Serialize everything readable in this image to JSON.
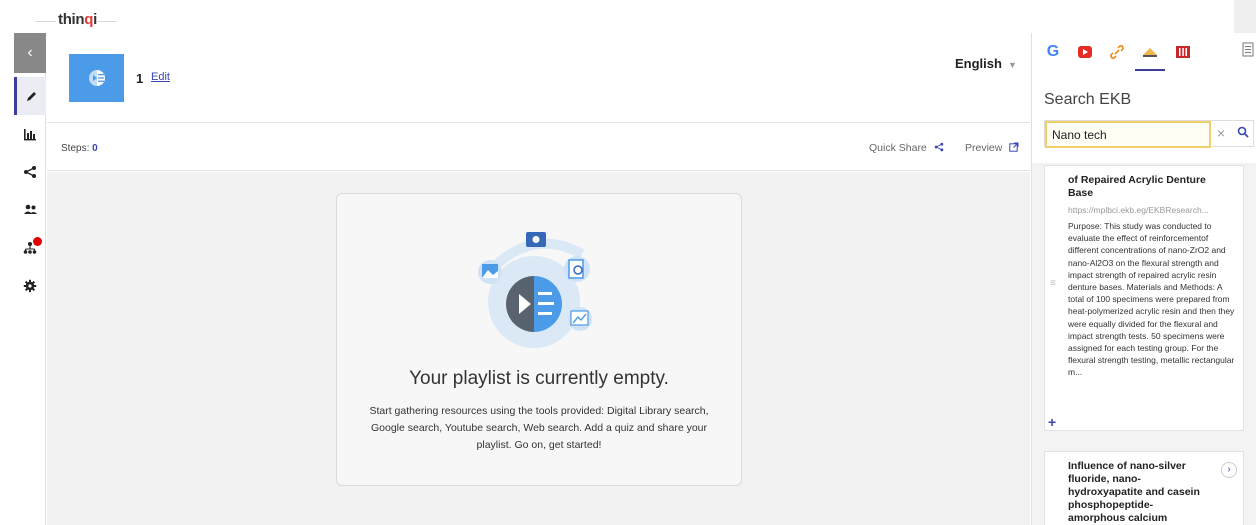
{
  "app": {
    "logo_prefix": "thin",
    "logo_accent": "q",
    "logo_suffix": "i"
  },
  "sidebar": {
    "collapse_label": "‹",
    "items": [
      "pencil-icon",
      "chart-bar-icon",
      "share-icon",
      "users-icon",
      "org-chart-icon",
      "gear-icon"
    ],
    "active": "pencil-icon",
    "badge_color": "#e00000"
  },
  "header": {
    "playlist_number": "1",
    "edit_label": "Edit",
    "language": "English",
    "language_caret": "▼"
  },
  "stepsbar": {
    "steps_label": "Steps:",
    "steps_count": "0",
    "quick_share": "Quick Share",
    "preview": "Preview"
  },
  "empty_state": {
    "title": "Your playlist is currently empty.",
    "description": "Start gathering resources using the tools provided: Digital Library search, Google search, Youtube search, Web search. Add a quiz and share your playlist. Go on, get started!"
  },
  "right_panel": {
    "tabs": [
      "google-icon",
      "youtube-icon",
      "link-icon",
      "ekb-icon",
      "library-icon"
    ],
    "google_label": "G",
    "active_tab": "ekb-icon",
    "search_title": "Search EKB",
    "search_value": "Nano tech",
    "clear_label": "×",
    "results": [
      {
        "title": "of Repaired Acrylic Denture Base",
        "url": "https://mplbci.ekb.eg/EKBResearch...",
        "abstract": "Purpose: This study was conducted to evaluate the effect of reinforcementof different concentrations of nano-ZrO2 and nano-Al2O3 on the flexural strength and impact strength of repaired acrylic resin denture bases. Materials and Methods: A total of 100 specimens were prepared from heat-polymerized acrylic resin and then they were equally divided for the flexural and impact strength tests. 50 specimens were assigned for each testing group. For the flexural strength testing, metallic rectangular m...",
        "add_label": "+",
        "handle_label": "≡"
      },
      {
        "title": "Influence of nano-silver fluoride, nano-hydroxyapatite and casein phosphopeptide-amorphous calcium phosphate on microhardness",
        "next_label": "›"
      }
    ]
  },
  "colors": {
    "accent": "#3b46b0",
    "thumb_blue": "#4c9be8",
    "search_highlight": "#f0d06a"
  }
}
